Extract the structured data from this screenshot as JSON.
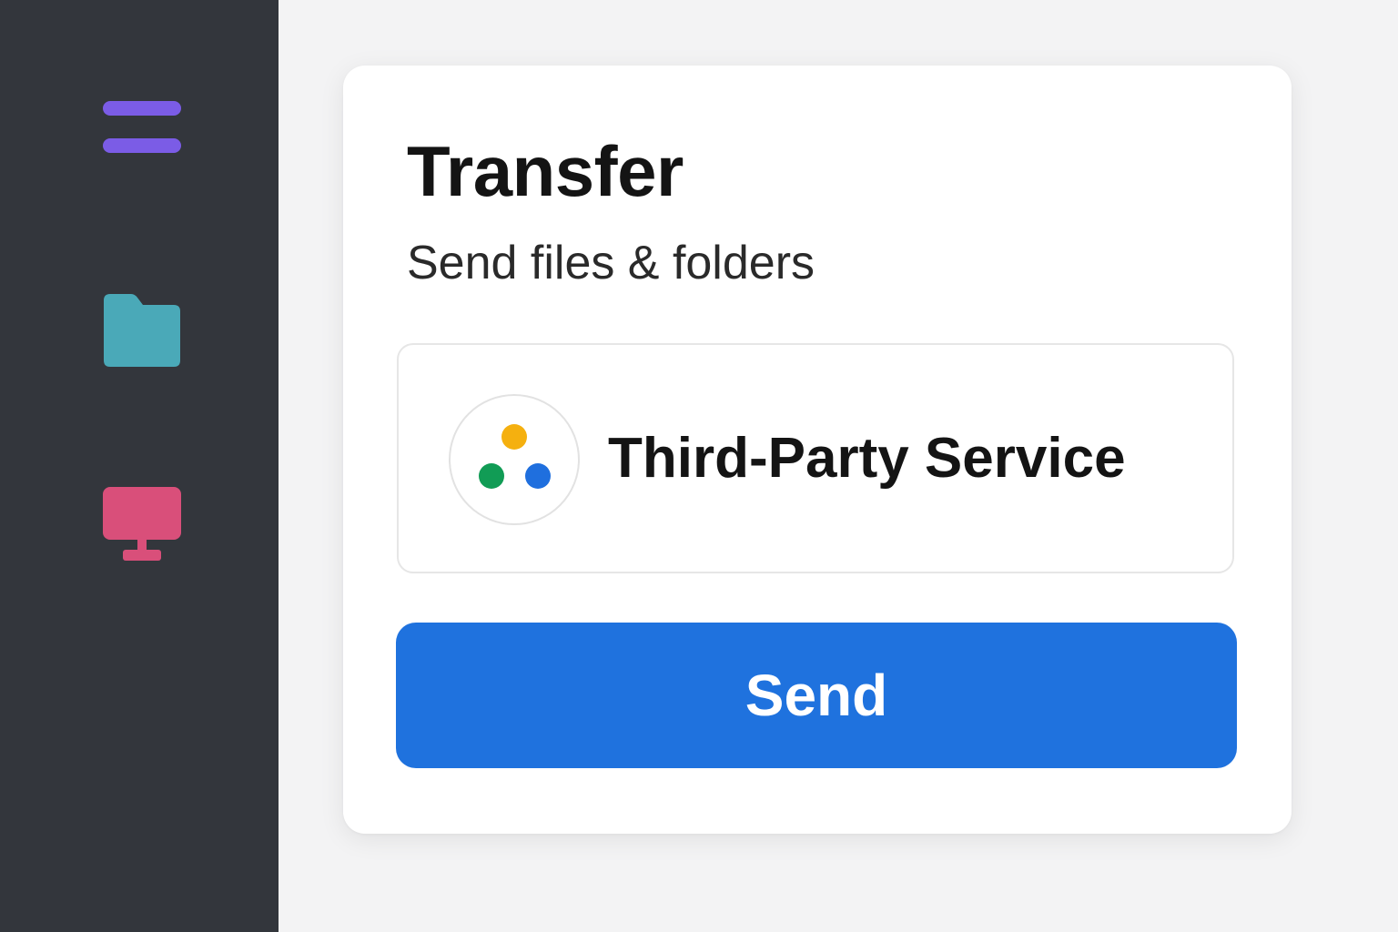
{
  "sidebar": {
    "items": [
      {
        "name": "menu",
        "icon": "hamburger-menu-icon",
        "color": "#7b5ce6"
      },
      {
        "name": "files",
        "icon": "folder-icon",
        "color": "#4aa9b8"
      },
      {
        "name": "screen",
        "icon": "monitor-icon",
        "color": "#d94f7a"
      }
    ],
    "background": "#33363c"
  },
  "card": {
    "title": "Transfer",
    "subtitle": "Send files & folders",
    "service": {
      "name": "Third-Party Service",
      "icon": "three-dots-logo-icon",
      "dot_colors": [
        "#f5b00f",
        "#119c55",
        "#1f6fde"
      ]
    },
    "send_label": "Send",
    "send_color": "#1f72de"
  },
  "background": "#f3f3f4"
}
